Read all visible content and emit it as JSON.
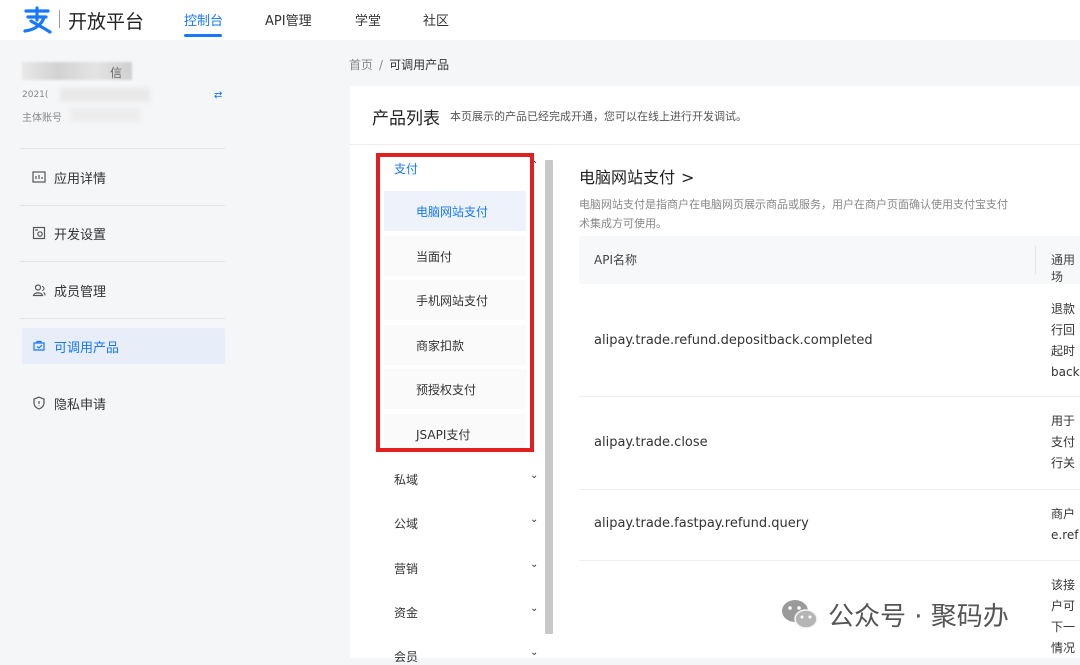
{
  "topbar": {
    "logo_text": "开放平台",
    "nav": [
      "控制台",
      "API管理",
      "学堂",
      "社区"
    ]
  },
  "sidebar": {
    "account_id_prefix": "2021(",
    "account_name_suffix": "信",
    "account_type_label": "主体账号",
    "items": [
      {
        "label": "应用详情",
        "icon": "app-detail-icon"
      },
      {
        "label": "开发设置",
        "icon": "dev-settings-icon"
      },
      {
        "label": "成员管理",
        "icon": "members-icon"
      },
      {
        "label": "可调用产品",
        "icon": "products-icon"
      },
      {
        "label": "隐私申请",
        "icon": "privacy-shield-icon"
      }
    ]
  },
  "breadcrumb": {
    "home": "首页",
    "sep": "/",
    "current": "可调用产品"
  },
  "card": {
    "title": "产品列表",
    "desc": "本页展示的产品已经完成开通，您可以在线上进行开发调试。"
  },
  "categories": {
    "open": "支付",
    "sub_items": [
      "电脑网站支付",
      "当面付",
      "手机网站支付",
      "商家扣款",
      "预授权支付",
      "JSAPI支付"
    ],
    "collapsed": [
      "私域",
      "公域",
      "营销",
      "资金",
      "会员"
    ]
  },
  "product": {
    "title": "电脑网站支付",
    "desc_line1": "电脑网站支付是指商户在电脑网页展示商品或服务，用户在商户页面确认使用支付宝支付",
    "desc_line2": "术集成方可使用。",
    "col_api": "API名称",
    "col_scope": "通用场",
    "rows": [
      {
        "api": "alipay.trade.refund.depositback.completed",
        "desc": "退款\n行回\n起时\nback"
      },
      {
        "api": "alipay.trade.close",
        "desc": "用于\n支付\n行关"
      },
      {
        "api": "alipay.trade.fastpay.refund.query",
        "desc": "商户\ne.ref"
      },
      {
        "api": "",
        "desc": "该接\n户可\n下一\n情况"
      }
    ]
  },
  "watermark": {
    "text": "公众号 · 聚码办"
  },
  "colors": {
    "accent": "#1677ff",
    "highlight_box": "#e02020"
  }
}
